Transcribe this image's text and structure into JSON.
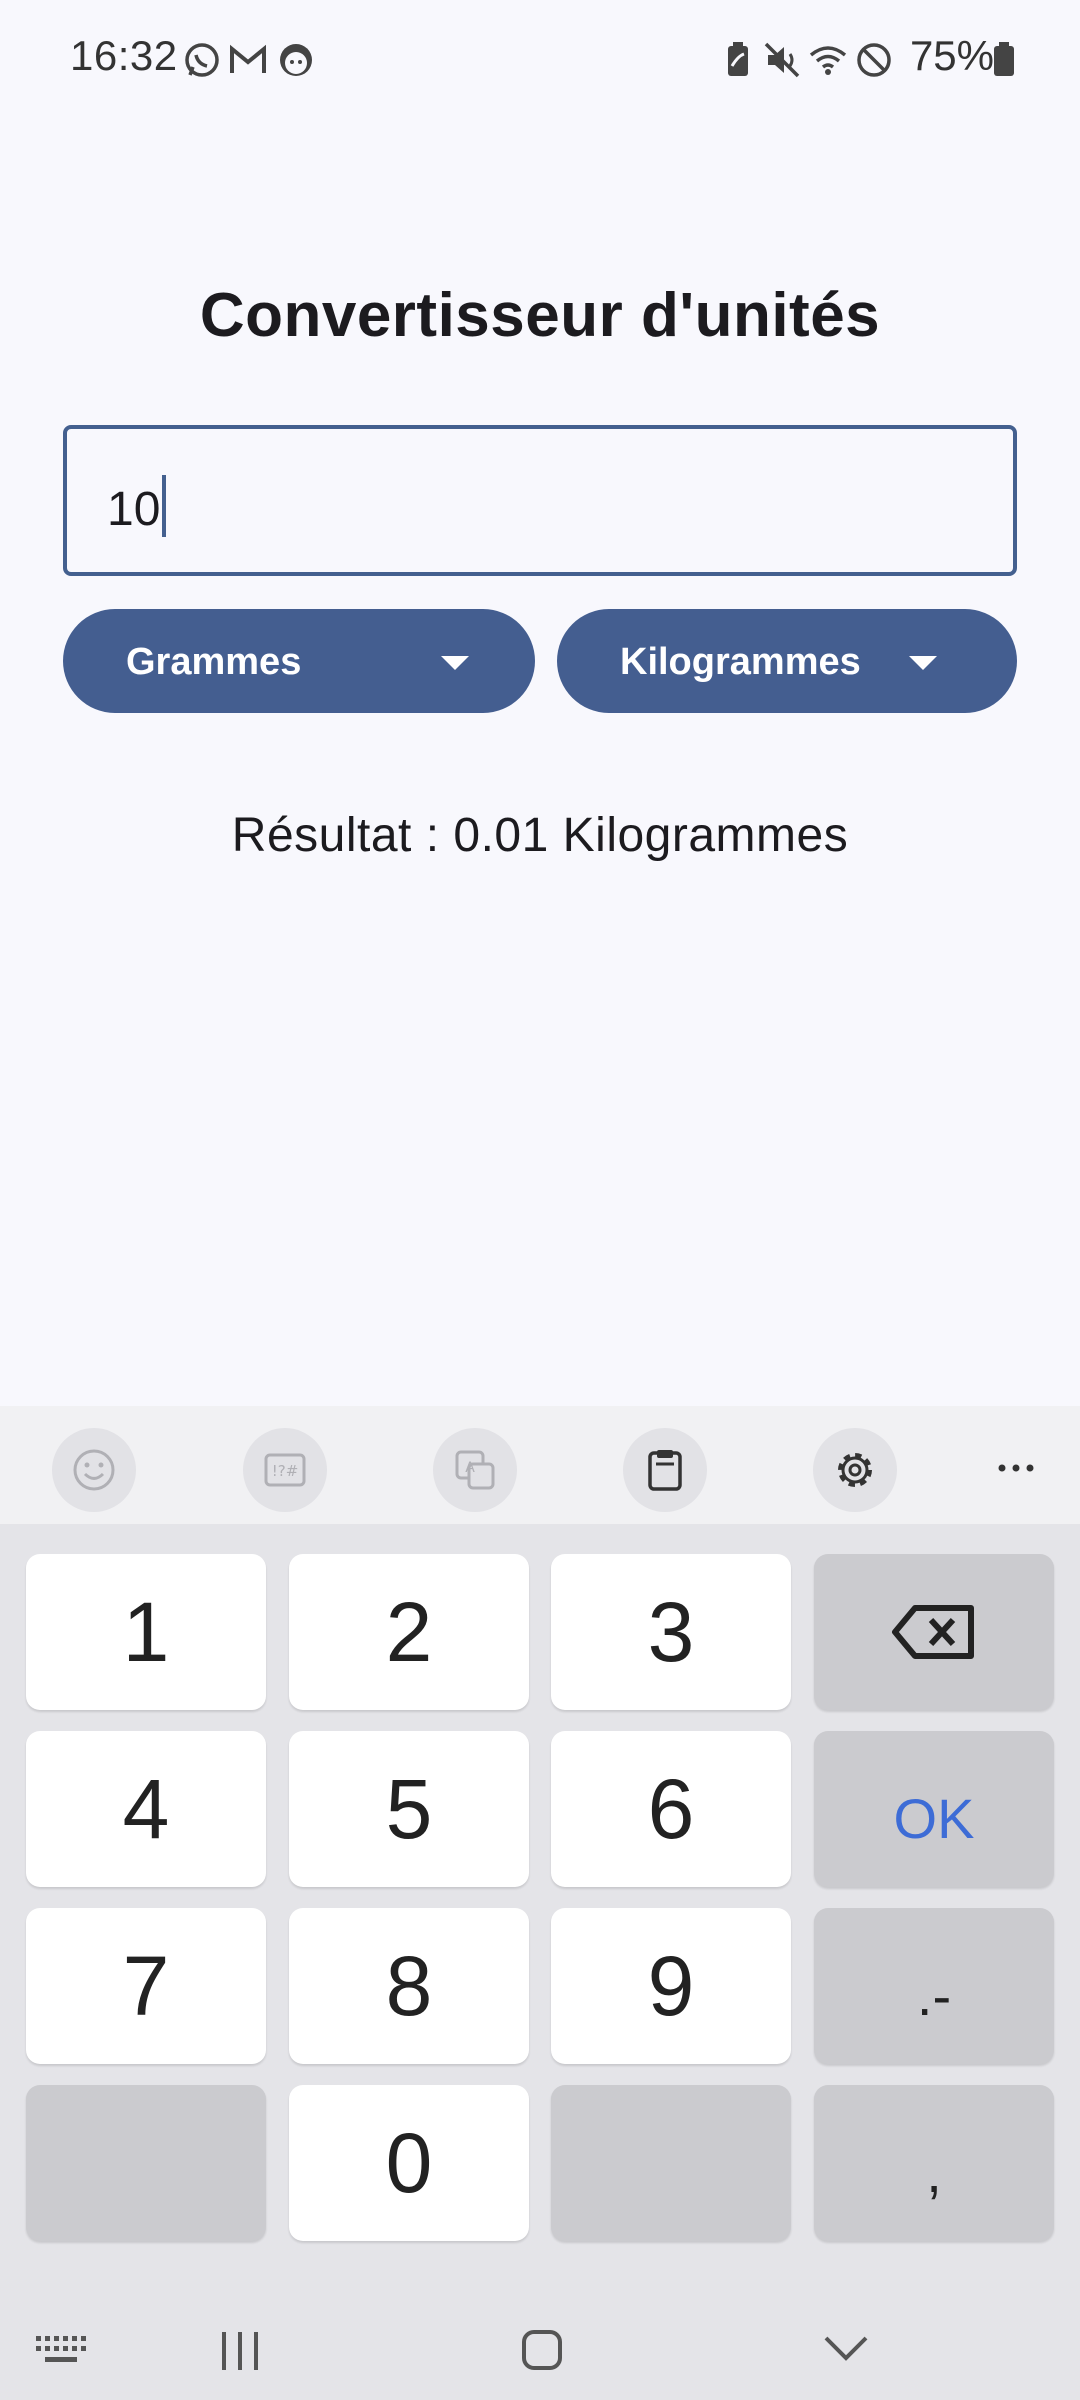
{
  "status_bar": {
    "time": "16:32",
    "battery": "75%",
    "icons": [
      "whatsapp-icon",
      "gmail-icon",
      "face-icon",
      "battery-saver-icon",
      "mute-icon",
      "wifi-icon",
      "do-not-disturb-icon",
      "battery-icon"
    ]
  },
  "app": {
    "title": "Convertisseur d'unités",
    "input_value": "10",
    "from_unit": "Grammes",
    "to_unit": "Kilogrammes",
    "result": "Résultat : 0.01 Kilogrammes",
    "accent_color": "#445e90"
  },
  "keyboard": {
    "toolbar": [
      "emoji-icon",
      "symbols-icon",
      "translate-icon",
      "clipboard-icon",
      "settings-icon",
      "more-icon"
    ],
    "rows": [
      [
        "1",
        "2",
        "3",
        "⌫"
      ],
      [
        "4",
        "5",
        "6",
        "OK"
      ],
      [
        "7",
        "8",
        "9",
        ".-"
      ],
      [
        "",
        "0",
        "",
        ","
      ]
    ],
    "ok_color": "#3d6cd6"
  },
  "nav_bar": {
    "icons": [
      "keyboard-icon",
      "recents-icon",
      "home-icon",
      "hide-keyboard-icon"
    ]
  }
}
